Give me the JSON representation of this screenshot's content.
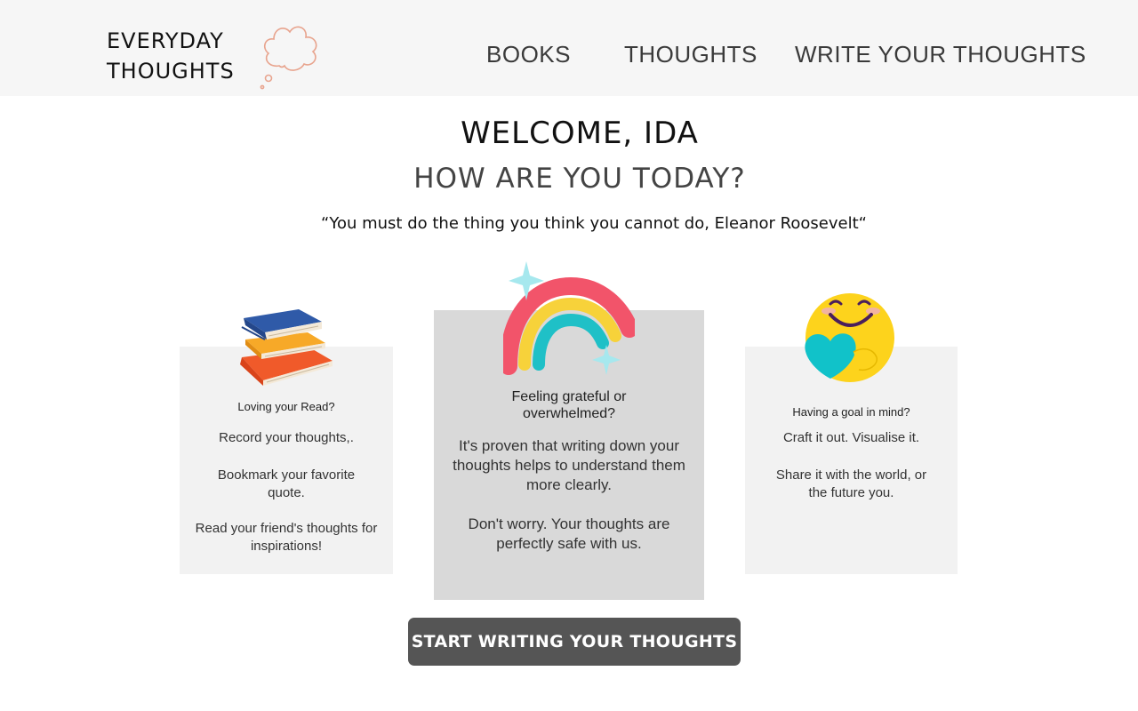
{
  "brand": {
    "line1": "EVERYDAY",
    "line2": "THOUGHTS",
    "logo_icon": "thought-cloud-icon",
    "logo_color": "#e8a48e"
  },
  "nav": {
    "books": "BOOKS",
    "thoughts": "THOUGHTS",
    "write": "WRITE YOUR THOUGHTS"
  },
  "hero": {
    "welcome": "WELCOME, IDA",
    "question": "HOW ARE YOU TODAY?",
    "quote": "“You must do the thing you think you cannot do, Eleanor Roosevelt“"
  },
  "cards": [
    {
      "icon": "book-stack-icon",
      "title": "Loving your Read?",
      "text1": "Record your thoughts,.",
      "text2": "Bookmark your favorite quote.",
      "text3": "Read your friend's thoughts for inspirations!"
    },
    {
      "icon": "rainbow-icon",
      "title": "Feeling grateful or overwhelmed?",
      "text1": "It's proven that writing down your thoughts helps to understand them more clearly.",
      "text2": "Don't worry. Your thoughts are perfectly safe with us."
    },
    {
      "icon": "smiley-hug-icon",
      "title": "Having a goal in mind?",
      "text1": "Craft it out. Visualise it.",
      "text2": "Share it with the world, or the future you."
    }
  ],
  "cta": {
    "label": "START WRITING YOUR THOUGHTS"
  },
  "colors": {
    "header_bg": "#f6f6f6",
    "card_bg": "#f2f2f2",
    "card_featured_bg": "#d9d9d9",
    "button_bg": "#555555",
    "button_text": "#ffffff"
  }
}
